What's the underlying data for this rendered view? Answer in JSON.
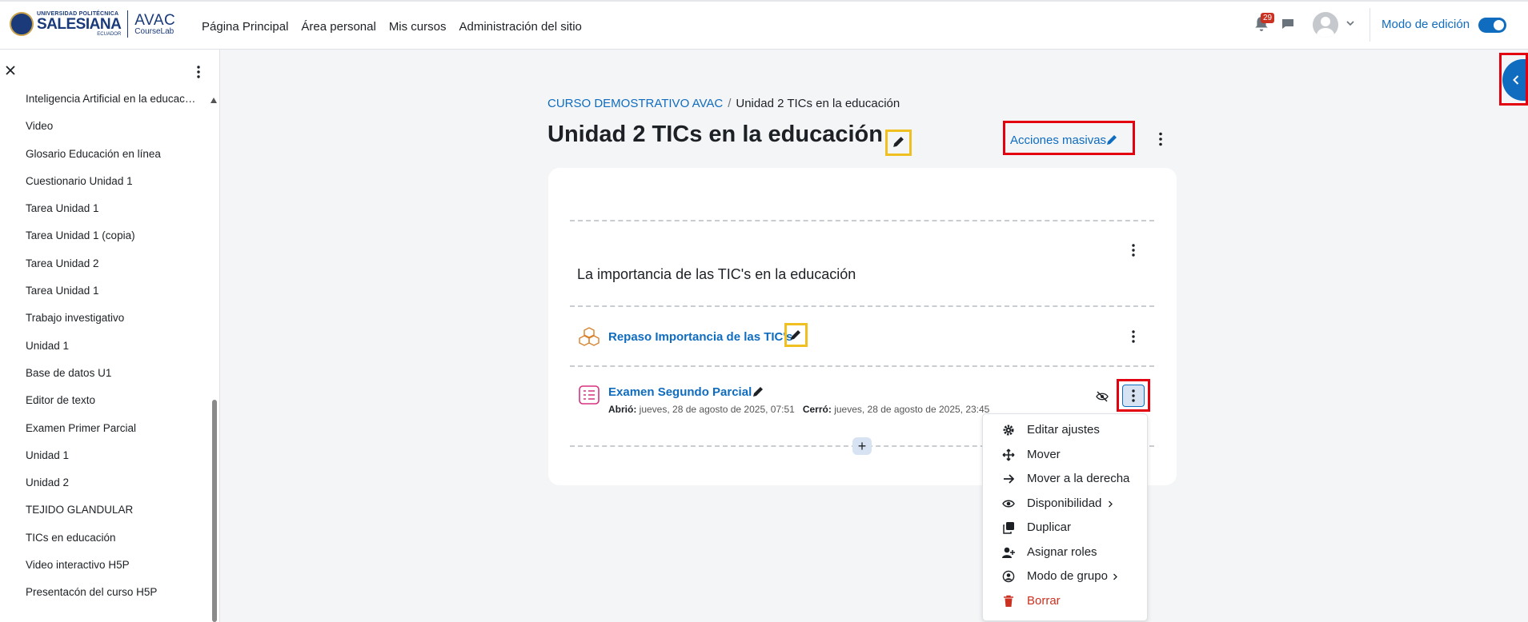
{
  "header": {
    "logo": {
      "university": "UNIVERSIDAD POLITÉCNICA",
      "name": "SALESIANA",
      "country": "ECUADOR",
      "app": "AVAC",
      "app_sub": "CourseLab"
    },
    "nav": [
      "Página Principal",
      "Área personal",
      "Mis cursos",
      "Administración del sitio"
    ],
    "notification_count": "29",
    "edit_mode_label": "Modo de edición"
  },
  "drawer": {
    "items": [
      "Inteligencia Artificial en la educación",
      "Video",
      "Glosario Educación en línea",
      "Cuestionario Unidad 1",
      "Tarea Unidad 1",
      "Tarea Unidad 1 (copia)",
      "Tarea Unidad 2",
      "Tarea Unidad 1",
      "Trabajo investigativo",
      "Unidad 1",
      "Base de datos U1",
      "Editor de texto",
      "Examen Primer Parcial",
      "Unidad 1",
      "Unidad 2",
      "TEJIDO GLANDULAR",
      "TICs en educación",
      "Video interactivo H5P",
      "Presentacón del curso H5P"
    ]
  },
  "breadcrumb": {
    "course": "CURSO DEMOSTRATIVO AVAC",
    "current": "Unidad 2 TICs en la educación"
  },
  "page_title": "Unidad 2 TICs en la educación",
  "bulk_actions_label": "Acciones masivas",
  "section": {
    "title": "La importancia de las TIC's en la educación",
    "activities": [
      {
        "name": "Repaso Importancia de las TIC's"
      },
      {
        "name": "Examen Segundo Parcial",
        "opened_label": "Abrió:",
        "opened": "jueves, 28 de agosto de 2025, 07:51",
        "closed_label": "Cerró:",
        "closed": "jueves, 28 de agosto de 2025, 23:45"
      }
    ]
  },
  "context_menu": [
    {
      "label": "Editar ajustes",
      "icon": "gear-icon"
    },
    {
      "label": "Mover",
      "icon": "move-icon"
    },
    {
      "label": "Mover a la derecha",
      "icon": "arrow-right-icon"
    },
    {
      "label": "Disponibilidad",
      "icon": "eye-icon"
    },
    {
      "label": "Duplicar",
      "icon": "copy-icon"
    },
    {
      "label": "Asignar roles",
      "icon": "user-plus-icon"
    },
    {
      "label": "Modo de grupo",
      "icon": "group-icon"
    },
    {
      "label": "Borrar",
      "icon": "trash-icon"
    }
  ],
  "colors": {
    "primary": "#0f6cbf",
    "danger": "#ca3120",
    "highlight_red": "#e3000f",
    "highlight_yellow": "#f0c020"
  }
}
